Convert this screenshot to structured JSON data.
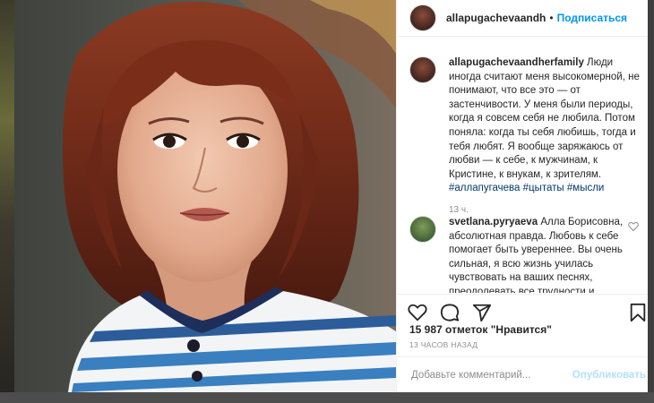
{
  "post": {
    "author": "allapugachevaandh",
    "separator": "•",
    "follow_label": "Подписаться"
  },
  "caption": {
    "author": "allapugachevaandherfamily",
    "text": "Люди иногда считают меня высокомерной, не понимают, что все это — от застенчивости. У меня были периоды, когда я совсем себя не любила. Потом поняла: когда ты себя любишь, тогда и тебя любят. Я вообще заряжаюсь от любви — к себе, к мужчинам, к Кристине, к внукам, к зрителям.",
    "hashtags": [
      "#аллапугачева",
      "#цытаты",
      "#мысли"
    ],
    "time": "13 ч."
  },
  "comment": {
    "author": "svetlana.pyryaeva",
    "text": "Алла Борисовна, абсолютная правда. Любовь к себе помогает быть увереннее. Вы очень сильная, я всю жизнь училась чувствовать на ваших песнях, преодолевать все трудности и верить в себя"
  },
  "stats": {
    "likes": "15 987 отметок \"Нравится\"",
    "posted": "13 ЧАСОВ НАЗАД"
  },
  "add_comment": {
    "placeholder": "Добавьте комментарий...",
    "publish_label": "Опубликовать"
  },
  "icons": [
    "close-icon",
    "heart-icon",
    "comment-icon",
    "share-icon",
    "bookmark-icon",
    "small-heart-icon"
  ],
  "colors": {
    "link_blue": "#0095f6",
    "hashtag": "#00376b",
    "muted": "#8e8e8e",
    "publish_disabled": "#b2dffc"
  }
}
